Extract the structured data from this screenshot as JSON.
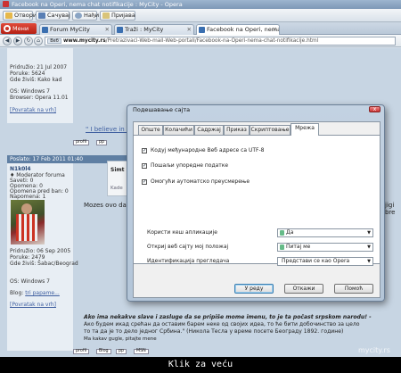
{
  "window": {
    "title": "Facebook na Operi, nema chat notifikacije : MyCity - Opera"
  },
  "toolbar": {
    "open": "Отвори",
    "save": "Сачувај",
    "find": "Нађи",
    "signin": "Пријава"
  },
  "tabs": {
    "menu": "Мени",
    "items": [
      {
        "label": "Forum MyCity"
      },
      {
        "label": "Traži : MyCity"
      },
      {
        "label": "Facebook na Operi, nema..."
      }
    ]
  },
  "address": {
    "badge": "Веб",
    "host": "www.mycity.rs",
    "path": "/Pretrazivaci-Web-mail-Web-portali/Facebook-na-Operi-nema-chat-notifikacije.html"
  },
  "forum": {
    "post1": {
      "joined": "Pridružio: 21 Jul 2007",
      "posts": "Poruke: 5624",
      "location": "Gde živiš: Kako kad",
      "os": "OS: Windows 7",
      "browser": "Browser: Opera 11.01",
      "back": "[Povratak na vrh]",
      "quote": "\" I believe in c"
    },
    "post2": {
      "header": "Poslato: 17 Feb 2011 01:40",
      "author": "N1k0l4",
      "role": "♦ Moderator foruma",
      "saved": "Saveti: 0",
      "warn": "Opomena: 0",
      "warn_ban": "Opomena pred ban: 0",
      "reward": "Napomena: 1",
      "joined": "Pridružio: 06 Sep 2005",
      "posts": "Poruke: 2479",
      "location": "Gde živiš: Šabac/Beograd",
      "os": "OS: Windows 7",
      "blog_label": "Blog:",
      "blog_link": "tri papame...",
      "back": "[Povratak na vrh]",
      "title_partial": "Simt",
      "field_partial": "Kade",
      "body_partial": "Mozes ovo da",
      "right_partial": "jigi bre",
      "sig_bold": "Ako ima nekakve slave i zasluge da se pripiše mome imenu, to je ta počast srpskom narodu! -",
      "sig_line2": "Ако будем икад срећан да оставим барем неке од својих идеа, то ће бити добочинство за цело",
      "sig_line3": "то та да је то дело једног Србина.\" (Никола Тесла у време посете Београду 1892. године)",
      "sig_small": "Ma kakav gugle, pitajte mene"
    },
    "buttons": [
      "profil",
      "pp"
    ],
    "buttons2": [
      "profil",
      "Blog",
      "pp",
      "MSN"
    ],
    "watermark": "mycity.rs"
  },
  "dialog": {
    "title": "Подешавање сајта",
    "close": "x",
    "tabs": [
      "Опште",
      "Колачићи",
      "Садржај",
      "Приказ",
      "Скриптовање",
      "Мрежа"
    ],
    "active_tab": "Мрежа",
    "checkboxes": [
      {
        "label": "Кодуј међународне Веб адресе са UTF-8",
        "checked": true
      },
      {
        "label": "Пошаљи упоредне податке",
        "checked": true
      },
      {
        "label": "Омогући аутоматско преусмерење",
        "checked": true
      }
    ],
    "fields": [
      {
        "label": "Користи кеш апликације",
        "value": "Да"
      },
      {
        "label": "Откриј веб сајту мој положај",
        "value": "Питај ме"
      },
      {
        "label": "Идентификација прегледача",
        "value": "Представи се као Opera"
      }
    ],
    "buttons": {
      "ok": "У реду",
      "cancel": "Откажи",
      "help": "Помоћ"
    }
  },
  "footer": {
    "text": "Klik za veću"
  }
}
